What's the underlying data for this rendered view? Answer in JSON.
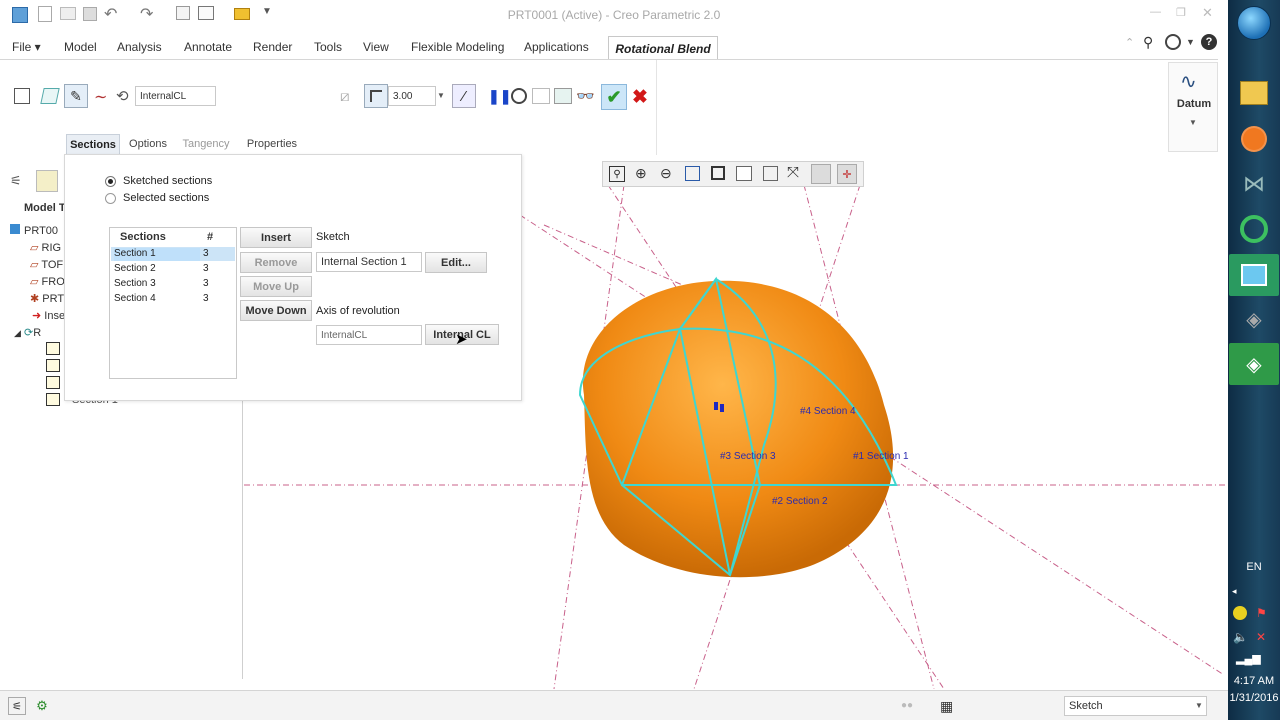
{
  "window": {
    "title": "PRT0001 (Active) - Creo Parametric 2.0"
  },
  "menu": {
    "items": [
      "File ▾",
      "Model",
      "Analysis",
      "Annotate",
      "Render",
      "Tools",
      "View",
      "Flexible Modeling",
      "Applications"
    ],
    "active_tab": "Rotational Blend"
  },
  "ribbon": {
    "axis_field": "InternalCL",
    "thickness_value": "3.00",
    "datum_label": "Datum"
  },
  "subtabs": [
    "Sections",
    "Options",
    "Tangency",
    "Properties"
  ],
  "sections_panel": {
    "radio_sketched": "Sketched sections",
    "radio_selected": "Selected sections",
    "list_header_name": "Sections",
    "list_header_count": "#",
    "rows": [
      {
        "name": "Section 1",
        "count": "3"
      },
      {
        "name": "Section 2",
        "count": "3"
      },
      {
        "name": "Section 3",
        "count": "3"
      },
      {
        "name": "Section 4",
        "count": "3"
      }
    ],
    "insert": "Insert",
    "remove": "Remove",
    "move_up": "Move Up",
    "move_down": "Move Down",
    "sketch_label": "Sketch",
    "sketch_value": "Internal Section 1",
    "edit": "Edit...",
    "axis_label": "Axis of revolution",
    "axis_value": "InternalCL",
    "internal_cl": "Internal CL"
  },
  "model_tree": {
    "title": "Model T",
    "items": [
      "PRT00",
      "RIG",
      "TOF",
      "FRO",
      "PRT",
      "Inse",
      "R",
      "Section 1"
    ]
  },
  "viewport": {
    "labels": [
      "#4 Section 4",
      "#3 Section 3",
      "#1 Section 1",
      "#2 Section 2"
    ],
    "colors": {
      "shape": "#f28e1c",
      "section_lines": "#3fd6d0",
      "datum_lines": "#c0608a"
    }
  },
  "status": {
    "mode": "Sketch"
  },
  "taskbar": {
    "lang": "EN",
    "time": "4:17 AM",
    "date": "1/31/2016"
  }
}
